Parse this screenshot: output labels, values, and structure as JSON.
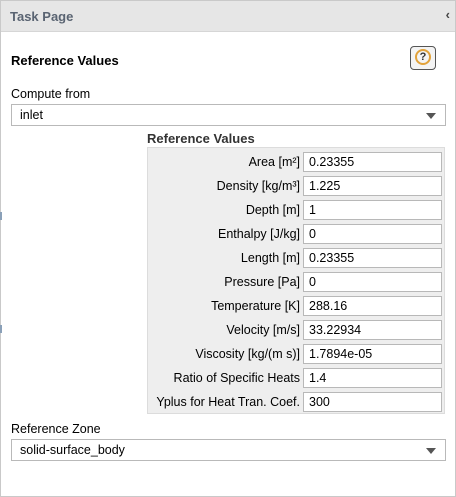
{
  "panel": {
    "title": "Task Page",
    "collapse_icon": "‹"
  },
  "section": {
    "title": "Reference Values",
    "help_icon": "?"
  },
  "compute_from": {
    "label": "Compute from",
    "value": "inlet"
  },
  "reference_values": {
    "header": "Reference Values",
    "rows": [
      {
        "label": "Area [m²]",
        "value": "0.23355"
      },
      {
        "label": "Density [kg/m³]",
        "value": "1.225"
      },
      {
        "label": "Depth [m]",
        "value": "1"
      },
      {
        "label": "Enthalpy [J/kg]",
        "value": "0"
      },
      {
        "label": "Length [m]",
        "value": "0.23355"
      },
      {
        "label": "Pressure [Pa]",
        "value": "0"
      },
      {
        "label": "Temperature [K]",
        "value": "288.16"
      },
      {
        "label": "Velocity [m/s]",
        "value": "33.22934"
      },
      {
        "label": "Viscosity [kg/(m s)]",
        "value": "1.7894e-05"
      },
      {
        "label": "Ratio of Specific Heats",
        "value": "1.4"
      },
      {
        "label": "Yplus for Heat Tran. Coef.",
        "value": "300"
      }
    ]
  },
  "reference_zone": {
    "label": "Reference Zone",
    "value": "solid-surface_body"
  }
}
